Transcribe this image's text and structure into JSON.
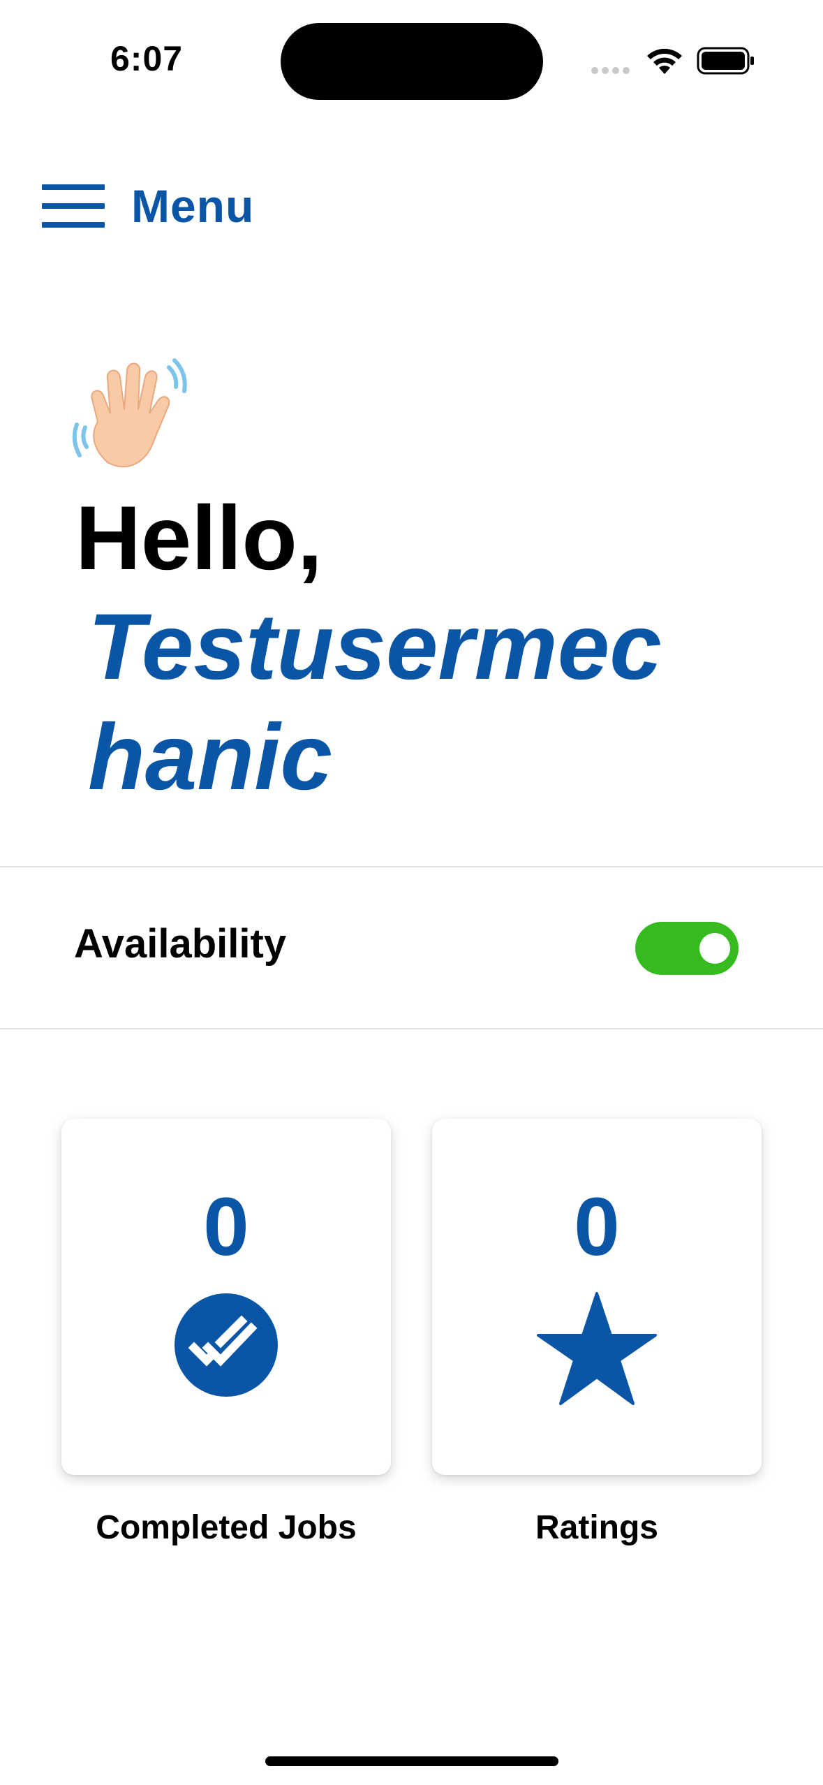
{
  "status_bar": {
    "time": "6:07"
  },
  "header": {
    "menu_label": "Menu"
  },
  "greeting": {
    "hello": "Hello,",
    "username": "Testusermechanic"
  },
  "availability": {
    "label": "Availability",
    "enabled": true
  },
  "stats": [
    {
      "value": "0",
      "caption": "Completed Jobs",
      "icon": "double-check-icon"
    },
    {
      "value": "0",
      "caption": "Ratings",
      "icon": "star-icon"
    }
  ],
  "colors": {
    "brand_blue": "#0a55a5",
    "toggle_on": "#35bb1e",
    "text": "#000000"
  }
}
